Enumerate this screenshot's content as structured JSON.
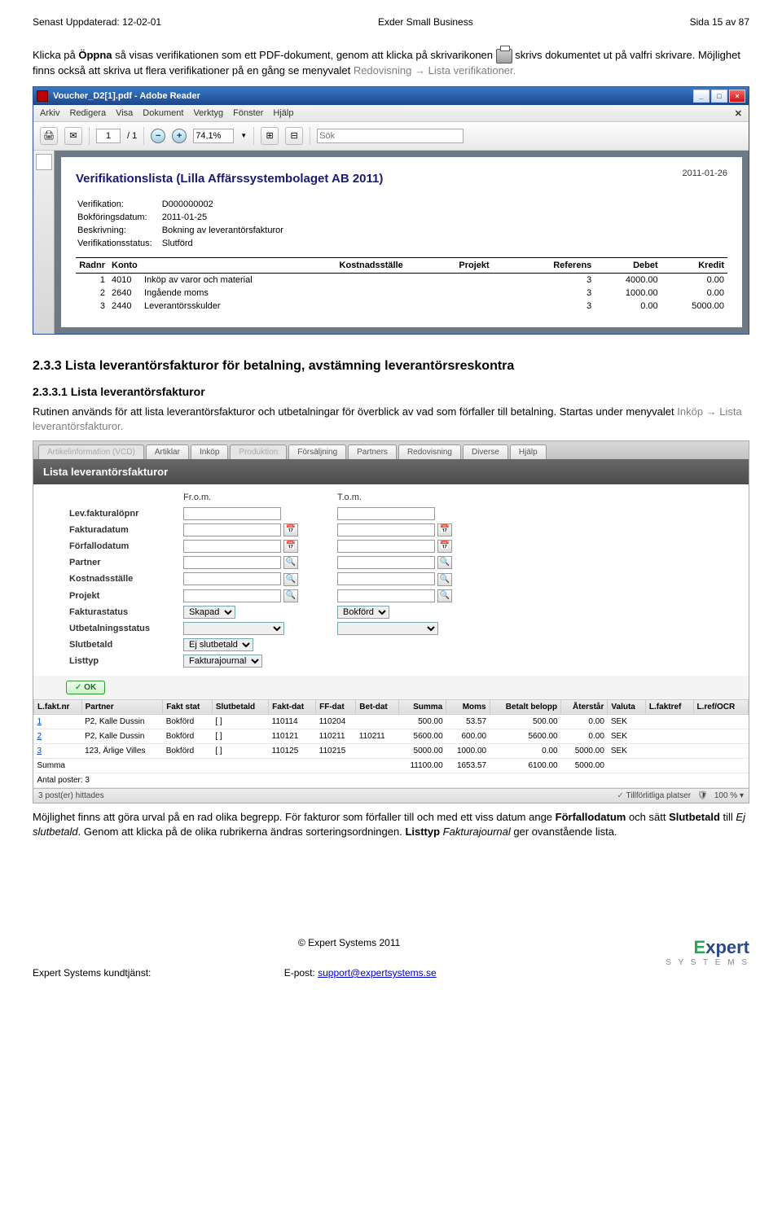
{
  "doc": {
    "updated_label": "Senast Uppdaterad: 12-02-01",
    "product": "Exder Small Business",
    "page_label": "Sida 15 av 87"
  },
  "intro": {
    "p1a": "Klicka på ",
    "p1b": "Öppna",
    "p1c": " så visas verifikationen som ett PDF-dokument, genom att klicka på skrivarikonen ",
    "p1d": " skrivs dokumentet ut på valfri skrivare. Möjlighet finns också att skriva ut flera verifikationer på en gång se menyvalet ",
    "p1e": "Redovisning",
    "p1f": " Lista verifikationer."
  },
  "adobe": {
    "title": "Voucher_D2[1].pdf - Adobe Reader",
    "menu": [
      "Arkiv",
      "Redigera",
      "Visa",
      "Dokument",
      "Verktyg",
      "Fönster",
      "Hjälp"
    ],
    "page_num": "1",
    "page_sep": "/ 1",
    "zoom": "74,1%",
    "search_ph": "Sök",
    "report_title": "Verifikationslista (Lilla Affärssystembolaget AB 2011)",
    "report_date": "2011-01-26",
    "meta": [
      [
        "Verifikation:",
        "D000000002"
      ],
      [
        "Bokföringsdatum:",
        "2011-01-25"
      ],
      [
        "Beskrivning:",
        "Bokning av leverantörsfakturor"
      ],
      [
        "Verifikationsstatus:",
        "Slutförd"
      ]
    ],
    "cols": [
      "Radnr",
      "Konto",
      "",
      "Kostnadsställe",
      "Projekt",
      "Referens",
      "Debet",
      "Kredit"
    ],
    "rows": [
      {
        "rad": "1",
        "konto": "4010",
        "txt": "Inköp av varor och material",
        "ks": "",
        "pr": "",
        "ref": "3",
        "deb": "4000.00",
        "kre": "0.00"
      },
      {
        "rad": "2",
        "konto": "2640",
        "txt": "Ingående moms",
        "ks": "",
        "pr": "",
        "ref": "3",
        "deb": "1000.00",
        "kre": "0.00"
      },
      {
        "rad": "3",
        "konto": "2440",
        "txt": "Leverantörsskulder",
        "ks": "",
        "pr": "",
        "ref": "3",
        "deb": "0.00",
        "kre": "5000.00"
      }
    ]
  },
  "sec": {
    "h233": "2.3.3  Lista leverantörsfakturor för betalning, avstämning leverantörsreskontra",
    "h2331": "2.3.3.1  Lista leverantörsfakturor",
    "p2a": "Rutinen används för att lista leverantörsfakturor och utbetalningar för överblick av vad som förfaller till betalning. Startas under menyvalet ",
    "p2b": "Inköp",
    "p2c": " Lista leverantörsfakturor."
  },
  "exder": {
    "tabs": [
      "Artikelinformation (VCD)",
      "Artiklar",
      "Inköp",
      "Produktion",
      "Försäljning",
      "Partners",
      "Redovisning",
      "Diverse",
      "Hjälp"
    ],
    "title": "Lista leverantörsfakturor",
    "from": "Fr.o.m.",
    "to": "T.o.m.",
    "fields": [
      {
        "label": "Lev.fakturalöpnr",
        "type": "text2"
      },
      {
        "label": "Fakturadatum",
        "type": "date2"
      },
      {
        "label": "Förfallodatum",
        "type": "date2"
      },
      {
        "label": "Partner",
        "type": "search2"
      },
      {
        "label": "Kostnadsställe",
        "type": "search2"
      },
      {
        "label": "Projekt",
        "type": "search2"
      },
      {
        "label": "Fakturastatus",
        "type": "select2",
        "v1": "Skapad",
        "v2": "Bokförd"
      },
      {
        "label": "Utbetalningsstatus",
        "type": "select2",
        "v1": "",
        "v2": ""
      },
      {
        "label": "Slutbetald",
        "type": "select1",
        "v1": "Ej slutbetald"
      },
      {
        "label": "Listtyp",
        "type": "select1",
        "v1": "Fakturajournal"
      }
    ],
    "ok": "OK",
    "cols": [
      "L.fakt.nr",
      "Partner",
      "Fakt stat",
      "Slutbetald",
      "Fakt-dat",
      "FF-dat",
      "Bet-dat",
      "Summa",
      "Moms",
      "Betalt belopp",
      "Återstår",
      "Valuta",
      "L.faktref",
      "L.ref/OCR"
    ],
    "rows": [
      {
        "nr": "1",
        "p": "P2, Kalle Dussin",
        "fs": "Bokförd",
        "sb": "[ ]",
        "fd": "110114",
        "ff": "110204",
        "bd": "",
        "sum": "500.00",
        "moms": "53.57",
        "bet": "500.00",
        "rest": "0.00",
        "val": "SEK",
        "lr": "",
        "ocr": ""
      },
      {
        "nr": "2",
        "p": "P2, Kalle Dussin",
        "fs": "Bokförd",
        "sb": "[ ]",
        "fd": "110121",
        "ff": "110211",
        "bd": "110211",
        "sum": "5600.00",
        "moms": "600.00",
        "bet": "5600.00",
        "rest": "0.00",
        "val": "SEK",
        "lr": "",
        "ocr": ""
      },
      {
        "nr": "3",
        "p": "123, Ärlige Villes",
        "fs": "Bokförd",
        "sb": "[ ]",
        "fd": "110125",
        "ff": "110215",
        "bd": "",
        "sum": "5000.00",
        "moms": "1000.00",
        "bet": "0.00",
        "rest": "5000.00",
        "val": "SEK",
        "lr": "",
        "ocr": ""
      }
    ],
    "summa_label": "Summa",
    "sumrow": {
      "sum": "11100.00",
      "moms": "1653.57",
      "bet": "6100.00",
      "rest": "5000.00"
    },
    "antal": "Antal poster: 3",
    "status_left": "3 post(er) hittades",
    "status_mid": "Tillförlitliga platser",
    "status_zoom": "100 %"
  },
  "outro": {
    "p1": "Möjlighet finns att göra urval på en rad olika begrepp. För fakturor som förfaller till och med ett viss datum ange ",
    "p2": "Förfallodatum",
    "p3": " och sätt ",
    "p4": "Slutbetald",
    "p5": " till ",
    "p6": "Ej slutbetald",
    "p7": ". Genom att klicka på de olika rubrikerna ändras sorteringsordningen. ",
    "p8": "Listtyp",
    "p9": " Fakturajournal ",
    "p10": "ger ovanstående lista."
  },
  "footer": {
    "copyright": "© Expert Systems 2011",
    "support_lbl": "Expert Systems kundtjänst:",
    "email_lbl": "E-post: ",
    "email": "support@expertsystems.se",
    "logo1": "E",
    "logo2": "xpert",
    "logo3": "S Y S T E M S"
  }
}
